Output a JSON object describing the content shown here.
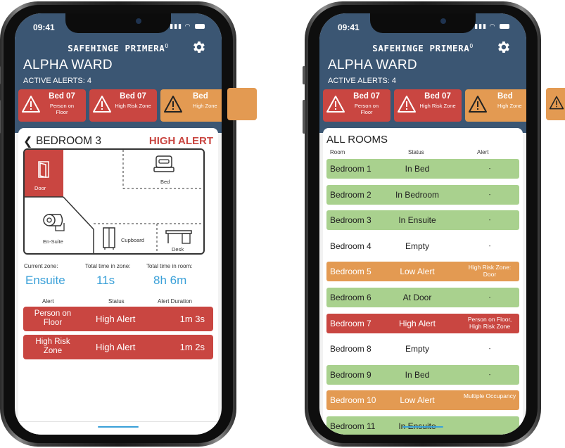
{
  "status_bar": {
    "time": "09:41"
  },
  "brand": {
    "name": "SAFEHINGE PRIMERA",
    "mark": "O"
  },
  "ward": {
    "name": "ALPHA WARD",
    "active_alerts": "ACTIVE ALERTS: 4"
  },
  "alert_cards": [
    {
      "bed": "Bed 07",
      "detail": "Person on Floor",
      "color": "#c94641"
    },
    {
      "bed": "Bed 07",
      "detail": "High Risk Zone",
      "color": "#c94641"
    },
    {
      "bed": "Bed",
      "detail": "High Zone",
      "color": "#e39a52"
    }
  ],
  "detail_screen": {
    "back_icon": "chevron-left-icon",
    "room": "BEDROOM 3",
    "alert_level": "HIGH ALERT",
    "floorplan": {
      "door": "Door",
      "bed": "Bed",
      "ensuite": "En-Suite",
      "cupboard": "Cupboard",
      "desk": "Desk"
    },
    "stats": {
      "current_zone_label": "Current zone:",
      "time_in_zone_label": "Total time in zone:",
      "time_in_room_label": "Total time in room:",
      "current_zone": "Ensuite",
      "time_in_zone": "11s",
      "time_in_room": "8h 6m"
    },
    "alert_table": {
      "headers": [
        "Alert",
        "Status",
        "Alert Duration"
      ],
      "rows": [
        {
          "alert": "Person on Floor",
          "status": "High Alert",
          "duration": "1m 3s"
        },
        {
          "alert": "High Risk Zone",
          "status": "High Alert",
          "duration": "1m 2s"
        }
      ]
    }
  },
  "rooms_screen": {
    "title": "ALL ROOMS",
    "headers": [
      "Room",
      "Status",
      "Alert"
    ],
    "rows": [
      {
        "room": "Bedroom 1",
        "status": "In Bed",
        "alert": "-",
        "state": "green"
      },
      {
        "room": "Bedroom 2",
        "status": "In Bedroom",
        "alert": "-",
        "state": "green"
      },
      {
        "room": "Bedroom 3",
        "status": "In Ensuite",
        "alert": "-",
        "state": "green"
      },
      {
        "room": "Bedroom 4",
        "status": "Empty",
        "alert": "-",
        "state": "white"
      },
      {
        "room": "Bedroom 5",
        "status": "Low Alert",
        "alert": "High Risk Zone: Door",
        "state": "orange"
      },
      {
        "room": "Bedroom 6",
        "status": "At Door",
        "alert": "-",
        "state": "green"
      },
      {
        "room": "Bedroom 7",
        "status": "High Alert",
        "alert": "Person on Floor, High Risk Zone",
        "state": "red"
      },
      {
        "room": "Bedroom 8",
        "status": "Empty",
        "alert": "-",
        "state": "white"
      },
      {
        "room": "Bedroom 9",
        "status": "In Bed",
        "alert": "-",
        "state": "green"
      },
      {
        "room": "Bedroom 10",
        "status": "Low Alert",
        "alert": "Multiple Occupancy",
        "state": "orange"
      },
      {
        "room": "Bedroom 11",
        "status": "In Ensuite",
        "alert": "",
        "state": "green"
      }
    ]
  },
  "colors": {
    "header": "#3b5673",
    "high_alert": "#c94641",
    "low_alert": "#e39a52",
    "ok": "#a9d18e",
    "accent": "#3aa0d8"
  }
}
